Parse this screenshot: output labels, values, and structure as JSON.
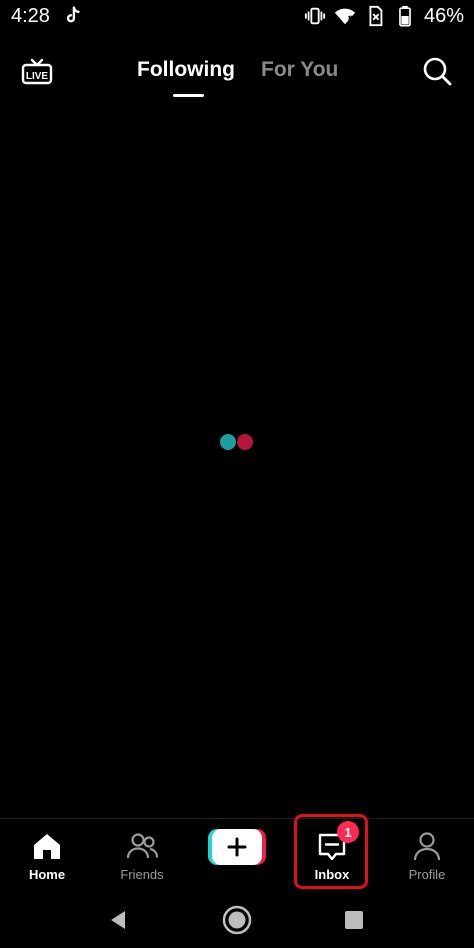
{
  "status_bar": {
    "time": "4:28",
    "battery": "46%",
    "icons": [
      "tiktok-icon",
      "vibrate-icon",
      "wifi-icon",
      "sim-off-icon",
      "battery-icon"
    ]
  },
  "top_nav": {
    "live_icon_label": "LIVE",
    "tabs": [
      {
        "label": "Following",
        "active": true
      },
      {
        "label": "For You",
        "active": false
      }
    ],
    "search_icon": "search-icon"
  },
  "loader": {
    "colors": [
      "#1f9e9e",
      "#b5163c"
    ]
  },
  "bottom_nav": {
    "items": [
      {
        "label": "Home",
        "icon": "home-icon",
        "active": true
      },
      {
        "label": "Friends",
        "icon": "friends-icon",
        "active": false
      },
      {
        "label": "",
        "icon": "plus-icon",
        "active": false
      },
      {
        "label": "Inbox",
        "icon": "inbox-icon",
        "active": false,
        "badge": "1"
      },
      {
        "label": "Profile",
        "icon": "profile-icon",
        "active": false
      }
    ]
  },
  "colors": {
    "background": "#000000",
    "inactive_tab": "#8a8a8a",
    "badge": "#fe2c55",
    "highlight": "#e0101a",
    "create_cyan": "#24d3d6",
    "create_red": "#ee1d52"
  },
  "system_nav": [
    "back-icon",
    "home-circle-icon",
    "recents-icon"
  ]
}
